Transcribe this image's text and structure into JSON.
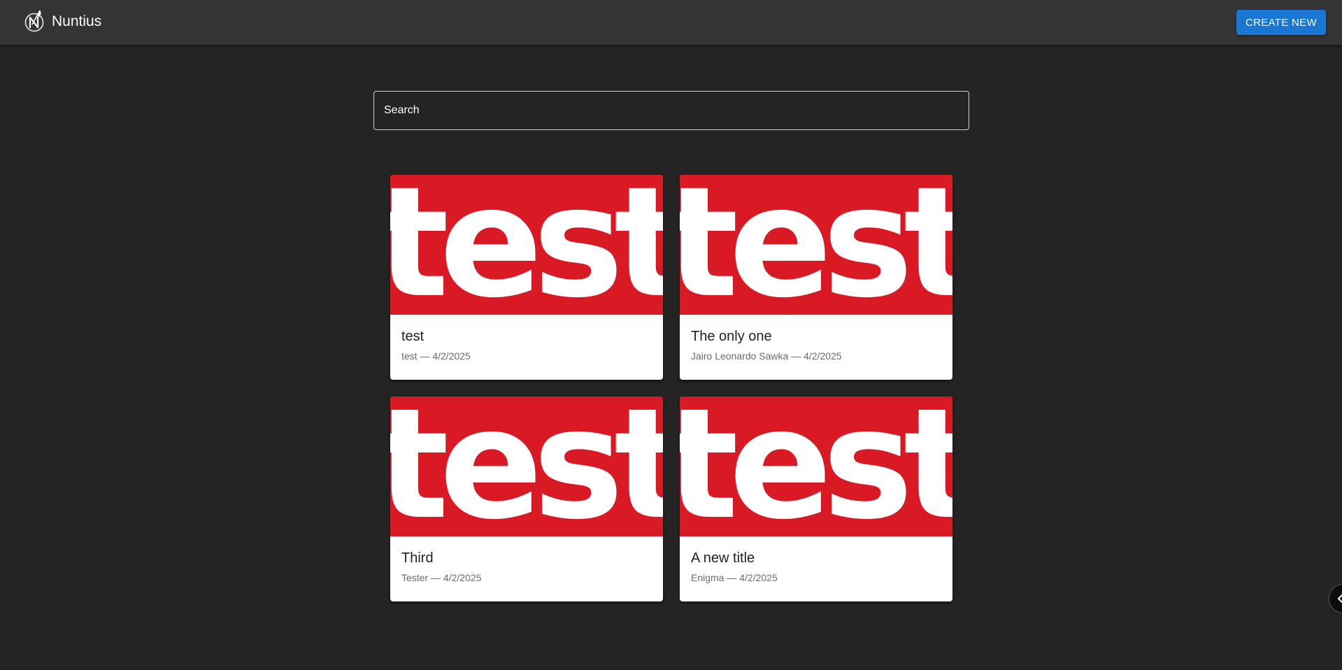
{
  "app": {
    "brand": "Nuntius",
    "create_label": "CREATE NEW"
  },
  "search": {
    "placeholder": "Search",
    "value": ""
  },
  "thumbnail_text": "test",
  "colors": {
    "background": "#242424",
    "appbar": "#343434",
    "accent": "#1976d2",
    "thumbnail": "#d91a24"
  },
  "posts": [
    {
      "title": "test",
      "author": "test",
      "date": "4/2/2025",
      "meta": "test — 4/2/2025"
    },
    {
      "title": "The only one",
      "author": "Jairo Leonardo Sawka",
      "date": "4/2/2025",
      "meta": "Jairo Leonardo Sawka — 4/2/2025"
    },
    {
      "title": "Third",
      "author": "Tester",
      "date": "4/2/2025",
      "meta": "Tester — 4/2/2025"
    },
    {
      "title": "A new title",
      "author": "Enigma",
      "date": "4/2/2025",
      "meta": "Enigma — 4/2/2025"
    }
  ],
  "icons": {
    "logo": "quill-n-logo-icon",
    "side_toggle": "chevron-left-icon"
  }
}
